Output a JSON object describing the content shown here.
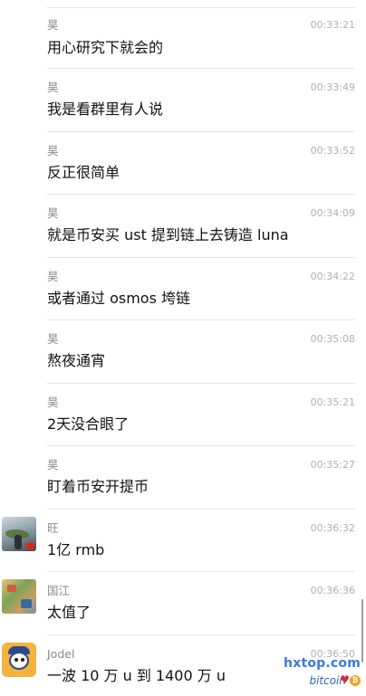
{
  "messages": [
    {
      "sender": "昊",
      "time": "00:33:21",
      "text": "用心研究下就会的",
      "avatar": "none"
    },
    {
      "sender": "昊",
      "time": "00:33:49",
      "text": "我是看群里有人说",
      "avatar": "none"
    },
    {
      "sender": "昊",
      "time": "00:33:52",
      "text": "反正很简单",
      "avatar": "none"
    },
    {
      "sender": "昊",
      "time": "00:34:09",
      "text": "就是币安买 ust 提到链上去铸造 luna",
      "avatar": "none"
    },
    {
      "sender": "昊",
      "time": "00:34:22",
      "text": "或者通过 osmos 垮链",
      "avatar": "none"
    },
    {
      "sender": "昊",
      "time": "00:35:08",
      "text": "熬夜通宵",
      "avatar": "none"
    },
    {
      "sender": "昊",
      "time": "00:35:21",
      "text": "2天没合眼了",
      "avatar": "none"
    },
    {
      "sender": "昊",
      "time": "00:35:27",
      "text": "盯着币安开提币",
      "avatar": "none"
    },
    {
      "sender": "旺",
      "time": "00:36:32",
      "text": "1亿 rmb",
      "avatar": "photo-landscape-avatar"
    },
    {
      "sender": "国江",
      "time": "00:36:36",
      "text": "太值了",
      "avatar": "colorful-map-avatar"
    },
    {
      "sender": "Jodel",
      "time": "00:36:50",
      "text": "一波 10 万 u 到 1400 万 u",
      "avatar": "cartoon-sailor-avatar"
    }
  ],
  "watermark": {
    "site": "hxtop.com",
    "brand": "bitcoin",
    "heart_icon": "heart-icon",
    "coin_icon": "bitcoin-coin-icon"
  },
  "colors": {
    "divider": "#e5e5e5",
    "sender": "#8a8a8a",
    "time": "#b0b0b0",
    "text": "#111111",
    "watermark": "#3a7ad9"
  }
}
